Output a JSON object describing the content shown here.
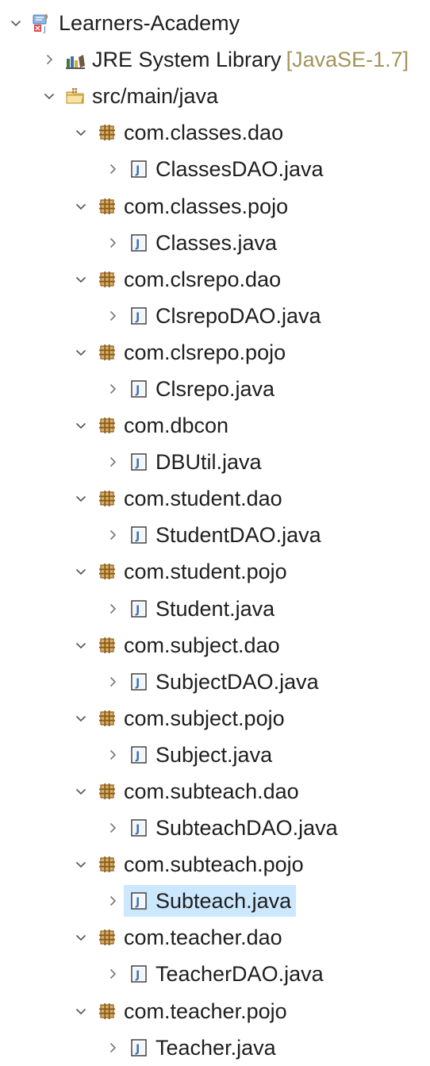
{
  "project": {
    "label": "Learners-Academy"
  },
  "jre": {
    "label": "JRE System Library",
    "decoration": "[JavaSE-1.7]"
  },
  "src": {
    "label": "src/main/java"
  },
  "packages": [
    {
      "label": "com.classes.dao",
      "file": "ClassesDAO.java"
    },
    {
      "label": "com.classes.pojo",
      "file": "Classes.java"
    },
    {
      "label": "com.clsrepo.dao",
      "file": "ClsrepoDAO.java"
    },
    {
      "label": "com.clsrepo.pojo",
      "file": "Clsrepo.java"
    },
    {
      "label": "com.dbcon",
      "file": "DBUtil.java"
    },
    {
      "label": "com.student.dao",
      "file": "StudentDAO.java"
    },
    {
      "label": "com.student.pojo",
      "file": "Student.java"
    },
    {
      "label": "com.subject.dao",
      "file": "SubjectDAO.java"
    },
    {
      "label": "com.subject.pojo",
      "file": "Subject.java"
    },
    {
      "label": "com.subteach.dao",
      "file": "SubteachDAO.java"
    },
    {
      "label": "com.subteach.pojo",
      "file": "Subteach.java"
    },
    {
      "label": "com.teacher.dao",
      "file": "TeacherDAO.java"
    },
    {
      "label": "com.teacher.pojo",
      "file": "Teacher.java"
    }
  ],
  "selected_file": "Subteach.java",
  "icons": {
    "project": "java-project-icon",
    "library": "library-icon",
    "source_folder": "source-folder-icon",
    "package": "package-icon",
    "java_file": "java-file-icon"
  },
  "colors": {
    "selection": "#cce8ff",
    "decoration": "#a3935c",
    "package": "#b07a2a"
  }
}
